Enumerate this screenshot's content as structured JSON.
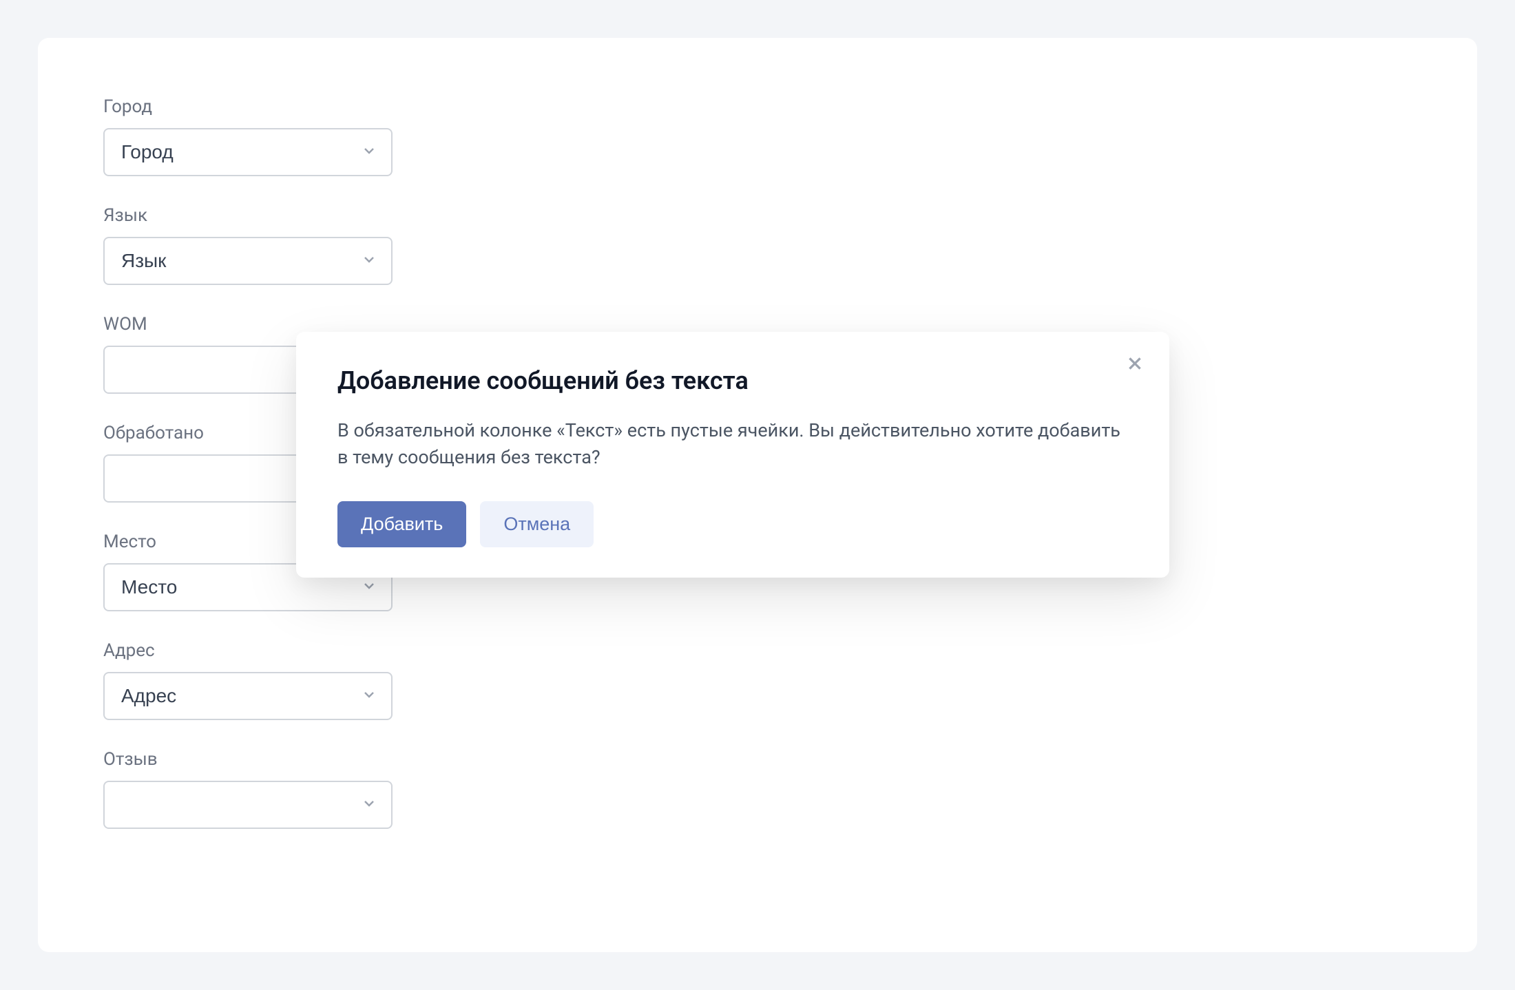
{
  "form": {
    "fields": [
      {
        "label": "Город",
        "value": "Город",
        "name": "city-select"
      },
      {
        "label": "Язык",
        "value": "Язык",
        "name": "language-select"
      },
      {
        "label": "WOM",
        "value": "",
        "name": "wom-select"
      },
      {
        "label": "Обработано",
        "value": "",
        "name": "processed-select"
      },
      {
        "label": "Место",
        "value": "Место",
        "name": "place-select"
      },
      {
        "label": "Адрес",
        "value": "Адрес",
        "name": "address-select"
      },
      {
        "label": "Отзыв",
        "value": "",
        "name": "review-select"
      }
    ]
  },
  "modal": {
    "title": "Добавление сообщений без текста",
    "body": "В обязательной колонке «Текст» есть пустые ячейки. Вы действительно хотите добавить в тему сообщения без текста?",
    "confirm_label": "Добавить",
    "cancel_label": "Отмена"
  }
}
